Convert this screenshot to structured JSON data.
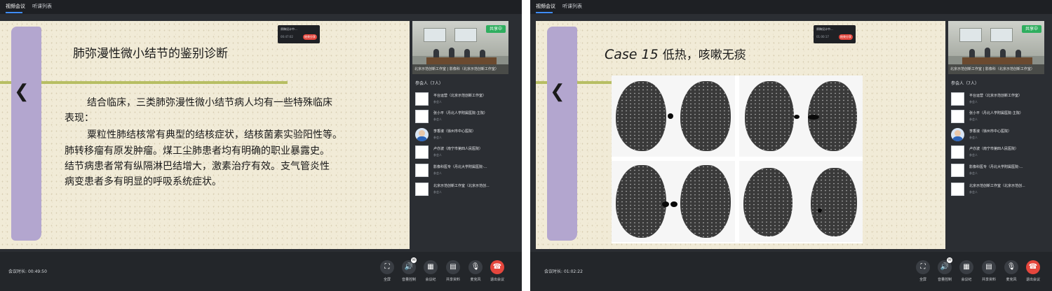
{
  "tabs": [
    "视频会议",
    "听课列表"
  ],
  "popup": {
    "title": "原稿设计中...",
    "time": "00:47:02",
    "button": "结束分享"
  },
  "popup_right": {
    "title": "原稿设计中...",
    "time": "01:00:17",
    "button": "结束分享"
  },
  "video": {
    "share_badge": "共享中",
    "caption": "北京示范创新工作室 | 影像科（北京示范创新工作室）"
  },
  "participants": {
    "header": "参会人（7人）",
    "items": [
      {
        "name": "平台运营（北京示范创新工作室）",
        "role": "参会人"
      },
      {
        "name": "张小平（丹北人学附属医院-主院）",
        "role": "参会人"
      },
      {
        "name": "李香淑（徐州市中心医院）",
        "role": "参会人"
      },
      {
        "name": "卢亦波（南宁市第四人民医院）",
        "role": "参会人"
      },
      {
        "name": "影像科医专（丹北大学附属医院-...",
        "role": "参会人"
      },
      {
        "name": "北京示范创新工作室（北京示范创...",
        "role": "参会人"
      }
    ]
  },
  "slide_left": {
    "title": "肺弥漫性微小结节的鉴别诊断",
    "lines": [
      "结合临床，三类肺弥漫性微小结节病人均有一些特殊临床",
      "表现：",
      "粟粒性肺结核常有典型的结核症状，结核菌素实验阳性等。",
      "肺转移瘤有原发肿瘤。煤工尘肺患者均有明确的职业暴露史。",
      "结节病患者常有纵隔淋巴结增大，激素治疗有效。支气管炎性",
      "病变患者多有明显的呼吸系统症状。"
    ]
  },
  "slide_right": {
    "case": "Case 15",
    "subtitle": "低热，咳嗽无痰"
  },
  "meeting_left": {
    "duration_label": "会议时长:",
    "duration": "00:49:50"
  },
  "meeting_right": {
    "duration_label": "会议时长:",
    "duration": "01:02:22"
  },
  "controls": [
    {
      "icon": "fullscreen-icon",
      "label": "全屏"
    },
    {
      "icon": "volume-icon",
      "label": "音量控制"
    },
    {
      "icon": "keypad-icon",
      "label": "会议纪"
    },
    {
      "icon": "document-icon",
      "label": "共享资料"
    },
    {
      "icon": "microphone-icon",
      "label": "麦克风"
    },
    {
      "icon": "hangup-icon",
      "label": "退出会议"
    }
  ],
  "volume_badge": "99",
  "colors": {
    "accent_tab": "#3f8cff",
    "hangup": "#e5463d",
    "share_green": "#2fae5f",
    "scroll_purple": "#b3a6cf",
    "slide_bg": "#f1ebd7"
  }
}
